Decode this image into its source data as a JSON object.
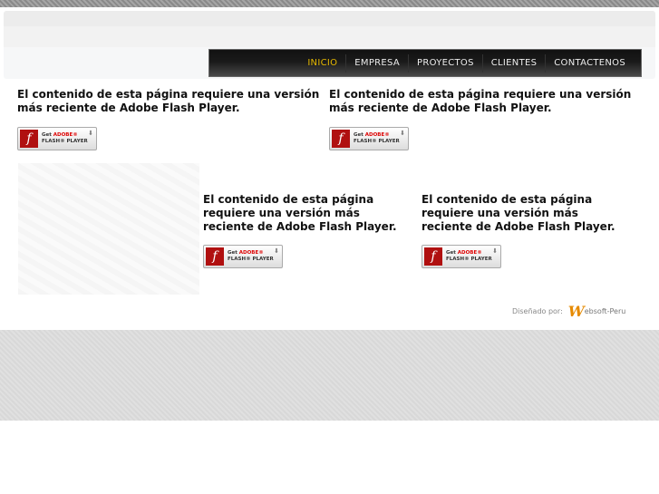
{
  "nav": {
    "items": [
      "INICIO",
      "EMPRESA",
      "PROYECTOS",
      "CLIENTES",
      "CONTACTENOS"
    ]
  },
  "flash_message": "El contenido de esta página requiere una versión más reciente de Adobe Flash Player.",
  "flash_button": {
    "get": "Get",
    "adobe": "ADOBE®",
    "player": "FLASH® PLAYER"
  },
  "credit": {
    "label": "Diseñado por:",
    "logo": "W",
    "brand": "ebsoft-Peru"
  },
  "colors": {
    "active_nav": "#e6b800",
    "flash_red": "#b01010"
  }
}
